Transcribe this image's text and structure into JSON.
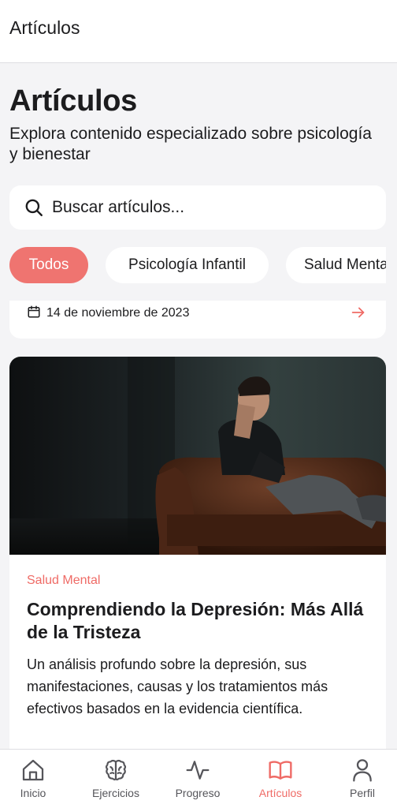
{
  "header": {
    "title": "Artículos"
  },
  "page": {
    "title": "Artículos",
    "subtitle": "Explora contenido especializado sobre psicología y bienestar"
  },
  "search": {
    "placeholder": "Buscar artículos...",
    "value": ""
  },
  "filters": [
    {
      "label": "Todos",
      "active": true
    },
    {
      "label": "Psicología Infantil",
      "active": false
    },
    {
      "label": "Salud Mental",
      "active": false
    }
  ],
  "previous_card": {
    "date": "14 de noviembre de 2023"
  },
  "article": {
    "category": "Salud Mental",
    "title": "Comprendiendo la Depresión: Más Allá de la Tristeza",
    "description": "Un análisis profundo sobre la depresión, sus manifestaciones, causas y los tratamientos más efectivos basados en la evidencia científica."
  },
  "bottom_nav": [
    {
      "label": "Inicio",
      "icon": "home-icon",
      "active": false
    },
    {
      "label": "Ejercicios",
      "icon": "brain-icon",
      "active": false
    },
    {
      "label": "Progreso",
      "icon": "activity-icon",
      "active": false
    },
    {
      "label": "Artículos",
      "icon": "book-open-icon",
      "active": true
    },
    {
      "label": "Perfil",
      "icon": "user-icon",
      "active": false
    }
  ],
  "colors": {
    "accent": "#ef7470",
    "background": "#f4f4f6",
    "text": "#1c1c1e"
  }
}
